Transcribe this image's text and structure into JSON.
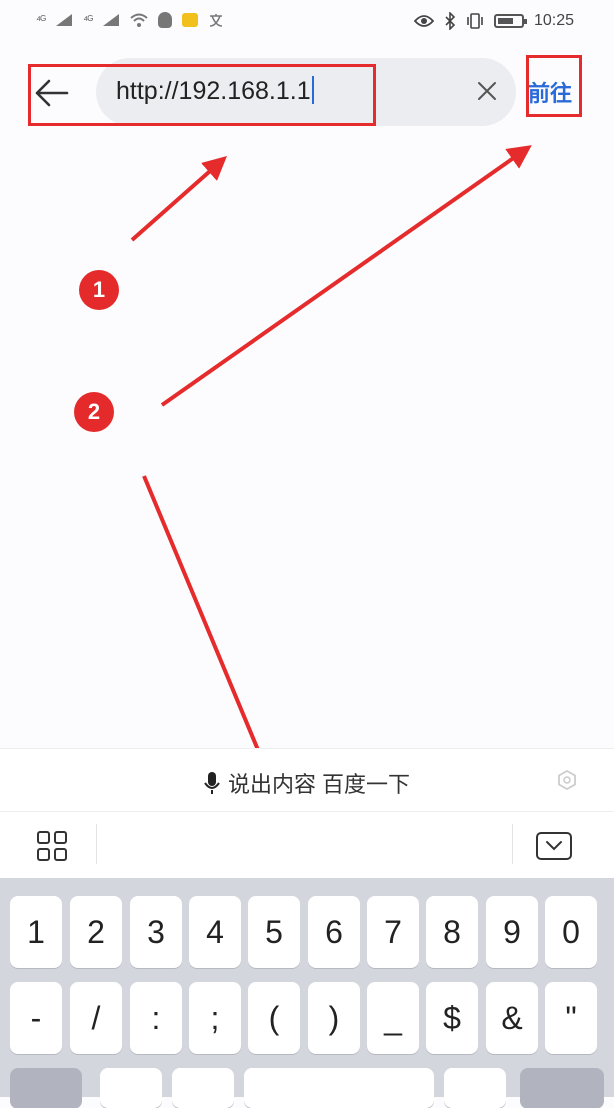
{
  "status_bar": {
    "signal_1": "⁴ᴳ",
    "signal_2": "⁴ᴳ",
    "time": "10:25"
  },
  "address_bar": {
    "url": "http://192.168.1.1",
    "go_label": "前往"
  },
  "annotations": {
    "step_1": "1",
    "step_2": "2",
    "highlight_color": "#e52b2b"
  },
  "voice_bar": {
    "hint": "说出内容 百度一下"
  },
  "keyboard": {
    "row1": [
      "1",
      "2",
      "3",
      "4",
      "5",
      "6",
      "7",
      "8",
      "9",
      "0"
    ],
    "row2": [
      "-",
      "/",
      ":",
      ";",
      "(",
      ")",
      "_",
      "$",
      "&",
      "\""
    ]
  },
  "colors": {
    "accent": "#2a6ad8",
    "annotation_red": "#e42a2a"
  }
}
